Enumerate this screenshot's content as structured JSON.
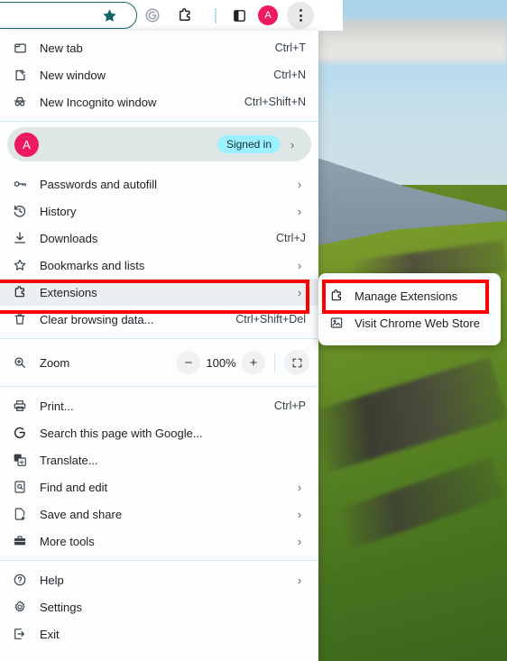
{
  "wallpaper": {
    "description": "green mountain hillside with rocks under a cloudy sky",
    "sky_color": "#b9dcee",
    "grass_color": "#5d8724",
    "rock_color": "#3e3c34"
  },
  "toolbar": {
    "omnibox_value": "",
    "icons": [
      {
        "name": "star-icon",
        "glyph": "★",
        "color": "#11636c",
        "title": "Bookmark this tab"
      },
      {
        "name": "grammarly-extension-icon",
        "title": "Grammarly"
      },
      {
        "name": "extensions-puzzle-icon",
        "title": "Extensions"
      },
      {
        "name": "toolbar-divider",
        "title": "divider"
      },
      {
        "name": "side-panel-icon",
        "title": "Side panel"
      }
    ],
    "avatar_letter": "A",
    "avatar_color": "#ec1a62",
    "more_button_label": "Customize and control Google Chrome"
  },
  "menu": {
    "top_group": [
      {
        "icon": "new-tab-icon",
        "label": "New tab",
        "shortcut": "Ctrl+T",
        "arrow": false
      },
      {
        "icon": "new-window-icon",
        "label": "New window",
        "shortcut": "Ctrl+N",
        "arrow": false
      },
      {
        "icon": "incognito-icon",
        "label": "New Incognito window",
        "shortcut": "Ctrl+Shift+N",
        "arrow": false
      }
    ],
    "profile": {
      "avatar_letter": "A",
      "avatar_color": "#ec1a62",
      "name": "",
      "badge": "Signed in",
      "badge_color": "#9df0ff",
      "arrow": "›"
    },
    "second_group": [
      {
        "icon": "key-icon",
        "label": "Passwords and autofill",
        "shortcut": "",
        "arrow": true
      },
      {
        "icon": "history-icon",
        "label": "History",
        "shortcut": "",
        "arrow": true
      },
      {
        "icon": "download-icon",
        "label": "Downloads",
        "shortcut": "Ctrl+J",
        "arrow": false
      },
      {
        "icon": "star-outline-icon",
        "label": "Bookmarks and lists",
        "shortcut": "",
        "arrow": true
      },
      {
        "icon": "extensions-puzzle-icon",
        "label": "Extensions",
        "shortcut": "",
        "arrow": true,
        "highlighted": true
      },
      {
        "icon": "trash-icon",
        "label": "Clear browsing data...",
        "shortcut": "Ctrl+Shift+Del",
        "arrow": false
      }
    ],
    "zoom": {
      "icon": "zoom-magnifier-icon",
      "label": "Zoom",
      "minus_label": "−",
      "value": "100%",
      "plus_label": "+",
      "fullscreen_icon": "fullscreen-icon"
    },
    "third_group": [
      {
        "icon": "printer-icon",
        "label": "Print...",
        "shortcut": "Ctrl+P",
        "arrow": false
      },
      {
        "icon": "google-g-icon",
        "label": "Search this page with Google...",
        "shortcut": "",
        "arrow": false
      },
      {
        "icon": "translate-icon",
        "label": "Translate...",
        "shortcut": "",
        "arrow": false
      },
      {
        "icon": "find-edit-icon",
        "label": "Find and edit",
        "shortcut": "",
        "arrow": true
      },
      {
        "icon": "save-share-icon",
        "label": "Save and share",
        "shortcut": "",
        "arrow": true
      },
      {
        "icon": "more-tools-icon",
        "label": "More tools",
        "shortcut": "",
        "arrow": true
      }
    ],
    "fourth_group": [
      {
        "icon": "help-icon",
        "label": "Help",
        "shortcut": "",
        "arrow": true
      },
      {
        "icon": "gear-icon",
        "label": "Settings",
        "shortcut": "",
        "arrow": false
      },
      {
        "icon": "exit-icon",
        "label": "Exit",
        "shortcut": "",
        "arrow": false
      }
    ]
  },
  "submenu": {
    "items": [
      {
        "icon": "extensions-puzzle-icon",
        "label": "Manage Extensions",
        "highlighted": true
      },
      {
        "icon": "web-store-icon",
        "label": "Visit Chrome Web Store",
        "highlighted": false
      }
    ]
  },
  "annotations": {
    "color": "#fe0000",
    "boxes": [
      {
        "name": "extensions-highlight",
        "target": "Extensions"
      },
      {
        "name": "manage-extensions-highlight",
        "target": "Manage Extensions"
      }
    ]
  }
}
